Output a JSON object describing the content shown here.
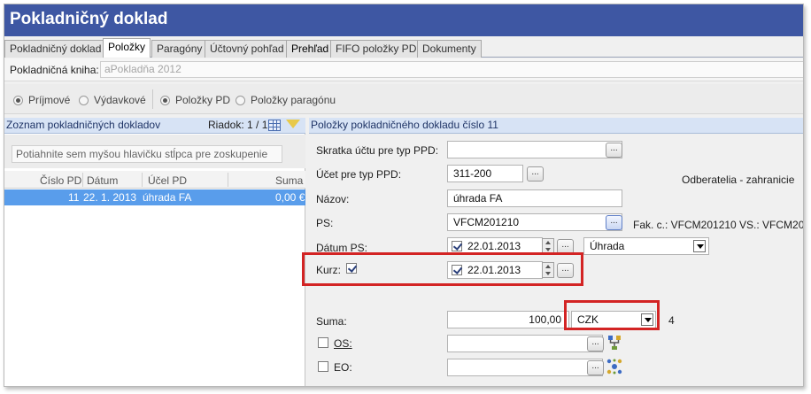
{
  "window": {
    "title": "Pokladničný doklad"
  },
  "tabs": [
    {
      "label": "Pokladničný doklad",
      "active": false
    },
    {
      "label": "Položky",
      "active": true
    },
    {
      "label": "Paragóny",
      "active": false
    },
    {
      "label": "Účtovný pohľad",
      "active": false
    },
    {
      "label": "Prehľad",
      "active": false
    },
    {
      "label": "FIFO položky PD",
      "active": false
    },
    {
      "label": "Dokumenty",
      "active": false
    }
  ],
  "kniha": {
    "label": "Pokladničná kniha:",
    "value": "aPokladňa 2012"
  },
  "radios": {
    "prijmove": "Príjmové",
    "vydavkove": "Výdavkové",
    "polozky_pd": "Položky PD",
    "polozky_paragonu": "Položky paragónu"
  },
  "left_panel": {
    "title": "Zoznam pokladničných dokladov",
    "row_counter": "Riadok: 1 / 1",
    "group_hint": "Potiahnite sem myšou hlavičku stĺpca pre zoskupenie",
    "columns": [
      "Číslo PD",
      "Dátum",
      "Účel PD",
      "Suma"
    ],
    "rows": [
      {
        "cislo": "11",
        "datum": "22. 1. 2013",
        "ucel": "úhrada FA",
        "suma": "0,00 €"
      }
    ]
  },
  "right_panel": {
    "title": "Položky pokladničného dokladu číslo 11",
    "skratka_label": "Skratka účtu pre typ PPD:",
    "skratka_value": "",
    "ucet_label": "Účet pre typ PPD:",
    "ucet_value": "311-200",
    "odberatelia_note": "Odberatelia - zahranicie",
    "nazov_label": "Názov:",
    "nazov_value": "úhrada FA",
    "ps_label": "PS:",
    "ps_value": "VFCM201210",
    "ps_note": "Fak. c.: VFCM201210 VS.: VFCM201210",
    "datum_ps_label": "Dátum PS:",
    "datum_ps_value": "22.01.2013",
    "uhrada_value": "Úhrada",
    "kurz_label": "Kurz:",
    "kurz_date_value": "22.01.2013",
    "suma_label": "Suma:",
    "suma_value": "100,00",
    "currency_value": "CZK",
    "currency_note": "4",
    "os_label": "OS:",
    "eo_label": "EO:"
  },
  "colors": {
    "titlebar": "#3e57a3",
    "highlight_red": "#d32424",
    "selected_row": "#3d8ce8"
  }
}
